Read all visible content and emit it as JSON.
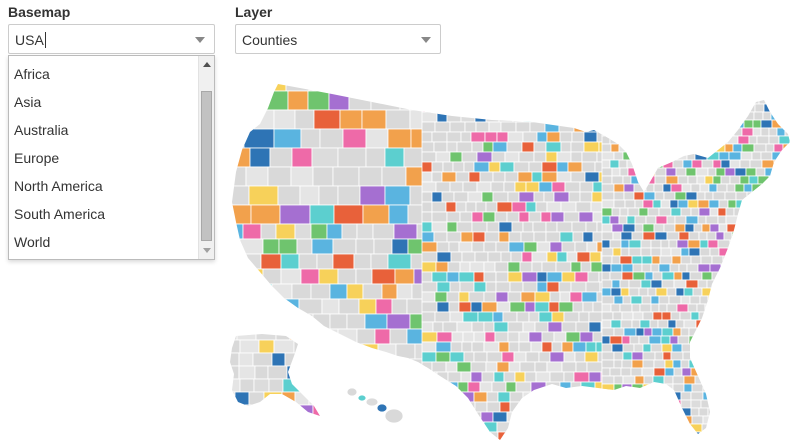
{
  "basemap": {
    "label": "Basemap",
    "value": "USA",
    "options": [
      "Africa",
      "Asia",
      "Australia",
      "Europe",
      "North America",
      "South America",
      "World"
    ]
  },
  "layer": {
    "label": "Layer",
    "value": "Counties"
  },
  "map": {
    "palette": [
      "#e5e5e5",
      "#e5e5e5",
      "#dcdcdc",
      "#6fc46e",
      "#a56fd1",
      "#f2a14c",
      "#5ab4e0",
      "#f7d15a",
      "#ee6aa8",
      "#5ccfcf",
      "#2e74b5",
      "#e8613a"
    ],
    "land_color": "#d9d9d9",
    "border_color": "#ffffff"
  }
}
